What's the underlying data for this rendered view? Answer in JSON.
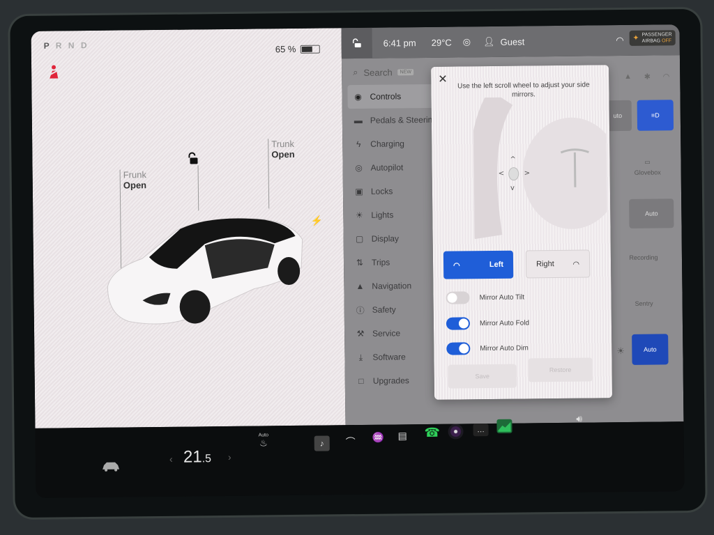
{
  "gear": {
    "letters": [
      "P",
      "R",
      "N",
      "D"
    ],
    "active": "P"
  },
  "battery": {
    "percent_label": "65 %",
    "level": 0.65
  },
  "car_status": {
    "frunk": {
      "label": "Frunk",
      "state": "Open"
    },
    "trunk": {
      "label": "Trunk",
      "state": "Open"
    },
    "lock_icon": "unlocked-icon",
    "charge_port_icon": "lightning-icon",
    "seatbelt_icon": "seatbelt-warning-icon"
  },
  "status_bar": {
    "time": "6:41 pm",
    "temperature": "29°C",
    "profile": "Guest",
    "airbag": {
      "line1": "PASSENGER",
      "line2_prefix": "AIRBAG",
      "line2_state": "OFF"
    }
  },
  "menu": {
    "search": {
      "label": "Search",
      "badge": "NEW"
    },
    "items": [
      {
        "label": "Controls",
        "icon": "toggle-icon",
        "active": true
      },
      {
        "label": "Pedals & Steering",
        "icon": "car-icon"
      },
      {
        "label": "Charging",
        "icon": "lightning-icon"
      },
      {
        "label": "Autopilot",
        "icon": "steering-wheel-icon"
      },
      {
        "label": "Locks",
        "icon": "lock-icon"
      },
      {
        "label": "Lights",
        "icon": "bulb-icon"
      },
      {
        "label": "Display",
        "icon": "display-icon"
      },
      {
        "label": "Trips",
        "icon": "trips-icon"
      },
      {
        "label": "Navigation",
        "icon": "navigation-icon"
      },
      {
        "label": "Safety",
        "icon": "alert-icon"
      },
      {
        "label": "Service",
        "icon": "wrench-icon"
      },
      {
        "label": "Software",
        "icon": "download-icon"
      },
      {
        "label": "Upgrades",
        "icon": "bag-icon"
      }
    ]
  },
  "controls_panel": {
    "tiles": {
      "auto_partial": "uto",
      "glovebox": "Glovebox",
      "wiper_auto": "Auto",
      "recording": "Recording",
      "sentry": "Sentry",
      "brightness_auto": "Auto"
    }
  },
  "mirror_modal": {
    "instruction": "Use the left scroll wheel to adjust your side mirrors.",
    "left_label": "Left",
    "right_label": "Right",
    "selected": "Left",
    "toggles": [
      {
        "label": "Mirror Auto Tilt",
        "on": false
      },
      {
        "label": "Mirror Auto Fold",
        "on": true
      },
      {
        "label": "Mirror Auto Dim",
        "on": true
      }
    ],
    "save_label": "Save",
    "restore_label": "Restore"
  },
  "bottom_bar": {
    "cabin_temp_whole": "21",
    "cabin_temp_decimal": ".5",
    "seat_heater_label": "Auto"
  }
}
